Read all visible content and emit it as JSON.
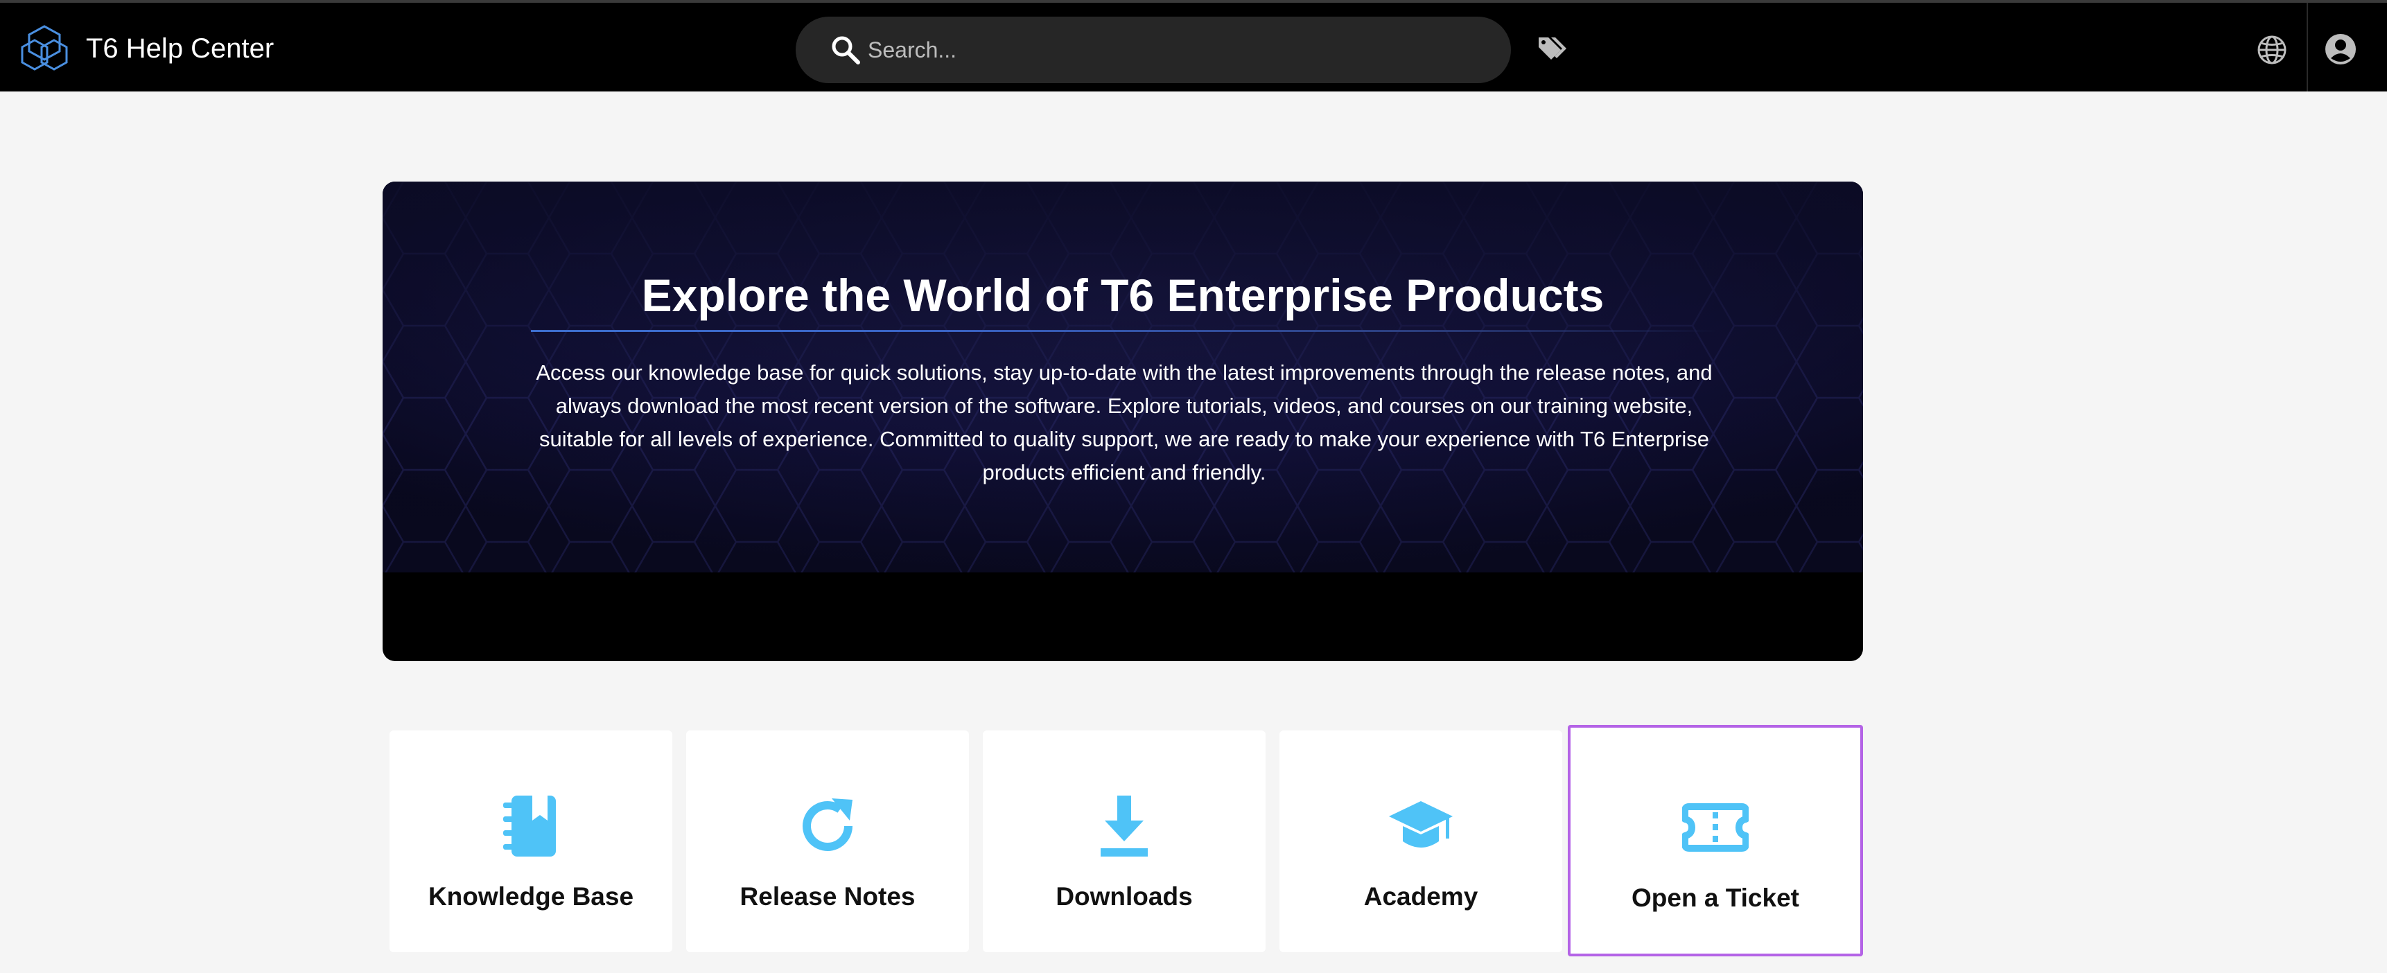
{
  "header": {
    "app_title": "T6 Help Center",
    "search_placeholder": "Search...",
    "icons": {
      "logo": "hexagon-logo-icon",
      "search": "search-icon",
      "tags": "tags-icon",
      "language": "globe-icon",
      "account": "account-icon"
    }
  },
  "hero": {
    "title": "Explore the World of T6 Enterprise Products",
    "description": "Access our knowledge base for quick solutions, stay up-to-date with the latest improvements through the release notes, and always download the most recent version of the software. Explore tutorials, videos, and courses on our training website, suitable for all levels of experience. Committed to quality support, we are ready to make your experience with T6 Enterprise products efficient and friendly."
  },
  "cards": [
    {
      "label": "Knowledge Base",
      "icon": "notebook-icon"
    },
    {
      "label": "Release Notes",
      "icon": "refresh-icon"
    },
    {
      "label": "Downloads",
      "icon": "download-icon"
    },
    {
      "label": "Academy",
      "icon": "graduation-cap-icon"
    },
    {
      "label": "Open a Ticket",
      "icon": "ticket-icon",
      "selected": true
    }
  ],
  "colors": {
    "topbar": "#000000",
    "page_background": "#f5f5f5",
    "card_icon": "#4fc3f7",
    "selected_outline": "#b463e6",
    "hero_rule": "#3d6fcf"
  }
}
